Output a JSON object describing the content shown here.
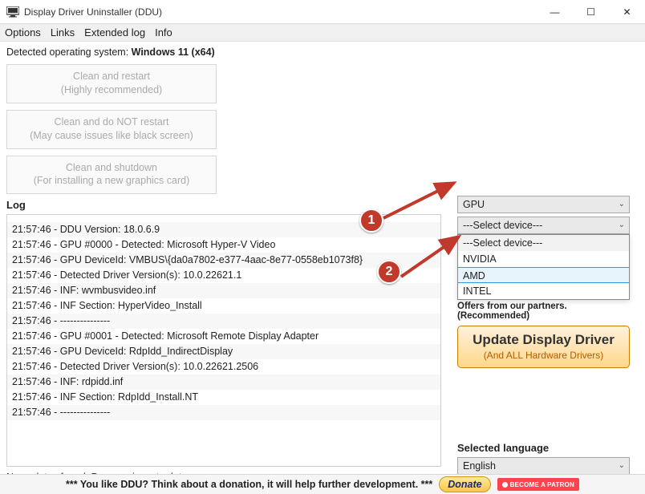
{
  "window": {
    "title": "Display Driver Uninstaller (DDU)",
    "controls": {
      "min": "—",
      "max": "☐",
      "close": "✕"
    }
  },
  "menubar": [
    "Options",
    "Links",
    "Extended log",
    "Info"
  ],
  "os": {
    "label": "Detected operating system: ",
    "value": "Windows 11 (x64)"
  },
  "actions": [
    {
      "line1": "Clean and restart",
      "line2": "(Highly recommended)"
    },
    {
      "line1": "Clean and do NOT restart",
      "line2": "(May cause issues like black screen)"
    },
    {
      "line1": "Clean and shutdown",
      "line2": "(For installing a new graphics card)"
    }
  ],
  "log": {
    "label": "Log",
    "entries": [
      "21:57:46 - DDU Version: 18.0.6.9",
      "21:57:46 - GPU #0000 - Detected: Microsoft Hyper-V Video",
      "21:57:46 - GPU DeviceId: VMBUS\\{da0a7802-e377-4aac-8e77-0558eb1073f8}",
      "21:57:46 - Detected Driver Version(s): 10.0.22621.1",
      "21:57:46 - INF: wvmbusvideo.inf",
      "21:57:46 - INF Section: HyperVideo_Install",
      "21:57:46 - ---------------",
      "21:57:46 - GPU #0001 - Detected: Microsoft Remote Display Adapter",
      "21:57:46 - GPU DeviceId: RdpIdd_IndirectDisplay",
      "21:57:46 - Detected Driver Version(s): 10.0.22621.2506",
      "21:57:46 - INF: rdpidd.inf",
      "21:57:46 - INF Section: RdpIdd_Install.NT",
      "21:57:46 - ---------------"
    ]
  },
  "status": "No updates found. Program is up to date.",
  "selectors": {
    "type": {
      "value": "GPU"
    },
    "device": {
      "value": "---Select device---",
      "options": [
        "---Select device---",
        "NVIDIA",
        "AMD",
        "INTEL"
      ],
      "highlighted": "AMD"
    }
  },
  "offers": {
    "label": "Offers from our partners. (Recommended)",
    "button": {
      "line1": "Update Display Driver",
      "line2": "(And ALL Hardware Drivers)"
    }
  },
  "language": {
    "label": "Selected language",
    "value": "English"
  },
  "footer": {
    "text": "*** You like DDU? Think about a donation, it will help further development. ***",
    "donate": "Donate",
    "patron": "BECOME A PATRON"
  },
  "annotations": {
    "one": "1",
    "two": "2"
  }
}
